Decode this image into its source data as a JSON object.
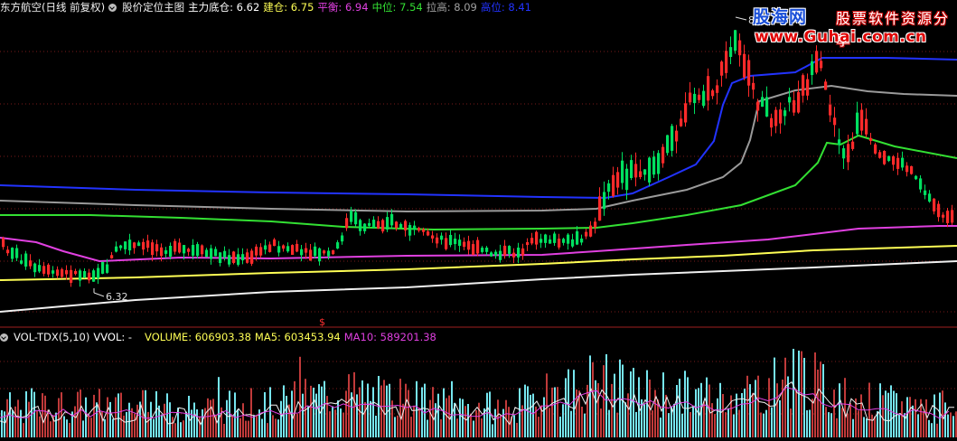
{
  "colors": {
    "background": "#000000",
    "up": "#ff2a2a",
    "down": "#00e060",
    "vol_up": "#c03a3a",
    "vol_down": "#76e6f0",
    "ma_main": "#f0f0f0",
    "yellow": "#ffff55",
    "magenta": "#e040e0",
    "green": "#33e033",
    "gray": "#9a9a9a",
    "blue": "#2233ff",
    "vol_ma5": "#f0f0f0",
    "vol_ma10": "#e040e0"
  },
  "header": {
    "title": "东方航空(日线 前复权)",
    "indicator": "股价定位主图",
    "items": [
      {
        "label": "主力底仓: 6.62",
        "color": "#ffffff"
      },
      {
        "label": "建仓: 6.75",
        "color": "#ffff55"
      },
      {
        "label": "平衡: 6.94",
        "color": "#e040e0"
      },
      {
        "label": "中位: 7.54",
        "color": "#33e033"
      },
      {
        "label": "拉高: 8.09",
        "color": "#a0a0a0"
      },
      {
        "label": "高位: 8.41",
        "color": "#2233ff"
      }
    ]
  },
  "vol_header": {
    "title": "VOL-TDX(5,10)",
    "items": [
      {
        "label": "VVOL: -",
        "color": "#ffffff"
      },
      {
        "label": "VOLUME: 606903.38",
        "color": "#ffff55"
      },
      {
        "label": "MA5: 603453.94",
        "color": "#ffff55"
      },
      {
        "label": "MA10: 589201.38",
        "color": "#e040e0"
      }
    ]
  },
  "watermark": {
    "line1": "股海网",
    "line2": "股票软件资源分享",
    "line3": "www.Guhai.com.cn"
  },
  "chart_data": {
    "type": "candlestick",
    "y_range_price": [
      6.2,
      8.7
    ],
    "annotations": {
      "low_label": "6.32",
      "high_label": "8",
      "marker": "$"
    },
    "notes": "Daily candles with support/resistance level lines; values estimated from the screenshot."
  }
}
